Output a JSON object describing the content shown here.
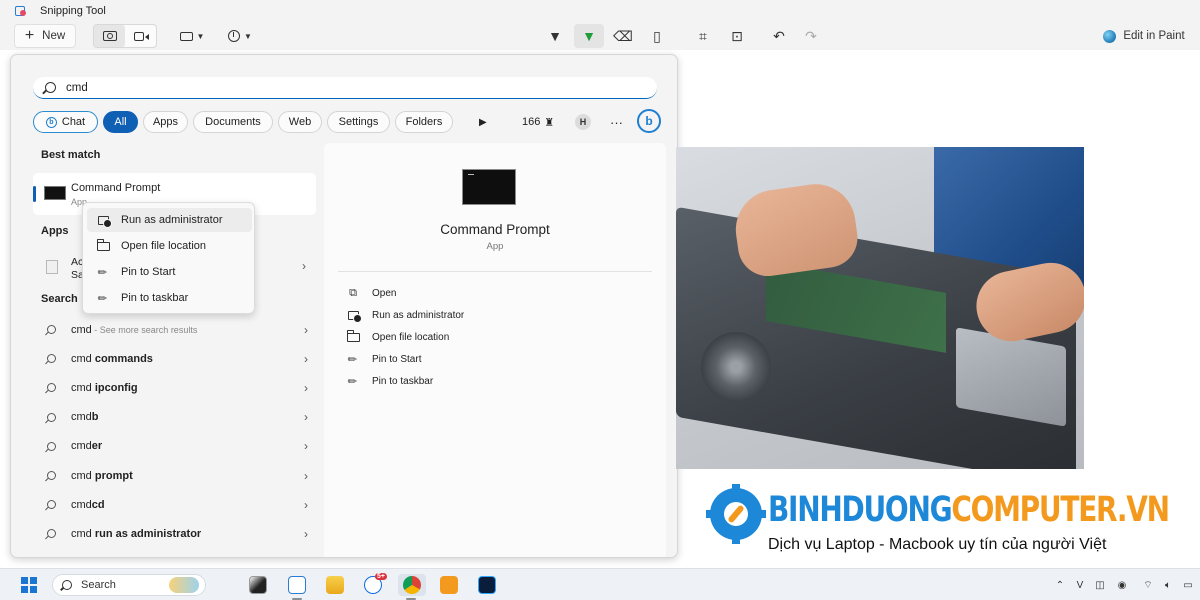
{
  "window": {
    "title": "Snipping Tool"
  },
  "toolbar": {
    "new_label": "New",
    "edit_in_paint_label": "Edit in Paint"
  },
  "start": {
    "search": {
      "query": "cmd"
    },
    "filters": {
      "chat": "Chat",
      "all": "All",
      "apps": "Apps",
      "documents": "Documents",
      "web": "Web",
      "settings": "Settings",
      "folders": "Folders",
      "points": "166",
      "avatar_initial": "H"
    },
    "best_match": {
      "heading": "Best match",
      "name": "Command Prompt",
      "kind": "App"
    },
    "apps_section": {
      "heading": "Apps",
      "item_line1": "Ac",
      "item_line2": "Sa"
    },
    "search_section": {
      "heading": "Search",
      "items": [
        {
          "prefix": "cmd",
          "bold": "",
          "hint": " - See more search results"
        },
        {
          "prefix": "cmd ",
          "bold": "commands",
          "hint": ""
        },
        {
          "prefix": "cmd ",
          "bold": "ipconfig",
          "hint": ""
        },
        {
          "prefix": "cmd",
          "bold": "b",
          "hint": ""
        },
        {
          "prefix": "cmd",
          "bold": "er",
          "hint": ""
        },
        {
          "prefix": "cmd ",
          "bold": "prompt",
          "hint": ""
        },
        {
          "prefix": "cmd",
          "bold": "cd",
          "hint": ""
        },
        {
          "prefix": "cmd ",
          "bold": "run as administrator",
          "hint": ""
        }
      ]
    },
    "context_menu": {
      "items": [
        {
          "label": "Run as administrator",
          "icon": "shield-icon"
        },
        {
          "label": "Open file location",
          "icon": "folder-icon"
        },
        {
          "label": "Pin to Start",
          "icon": "pin-icon"
        },
        {
          "label": "Pin to taskbar",
          "icon": "pin-icon"
        }
      ]
    },
    "detail": {
      "name": "Command Prompt",
      "kind": "App",
      "actions": [
        {
          "label": "Open",
          "icon": "open-icon"
        },
        {
          "label": "Run as administrator",
          "icon": "shield-icon"
        },
        {
          "label": "Open file location",
          "icon": "folder-icon"
        },
        {
          "label": "Pin to Start",
          "icon": "pin-icon"
        },
        {
          "label": "Pin to taskbar",
          "icon": "pin-icon"
        }
      ]
    }
  },
  "brand": {
    "name_part1": "BINHDUONG",
    "name_part2": "COMPUTER.VN",
    "tagline": "Dịch vụ Laptop - Macbook uy tín của người Việt",
    "color_primary": "#1e88d8",
    "color_secondary": "#f39a1e"
  },
  "taskbar": {
    "search_label": "Search",
    "zalo_badge": "5+"
  }
}
